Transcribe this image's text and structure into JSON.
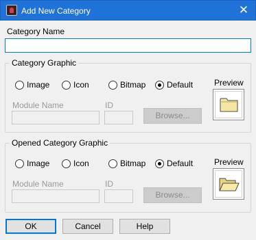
{
  "window": {
    "title": "Add New Category",
    "close_glyph": "✕",
    "icon": "app-icon"
  },
  "category_name": {
    "label": "Category Name",
    "value": ""
  },
  "groups": [
    {
      "title": "Category Graphic",
      "radios": [
        {
          "label": "Image",
          "checked": false
        },
        {
          "label": "Icon",
          "checked": false
        },
        {
          "label": "Bitmap",
          "checked": false
        },
        {
          "label": "Default",
          "checked": true
        }
      ],
      "module_label": "Module Name",
      "id_label": "ID",
      "browse_label": "Browse...",
      "preview_label": "Preview",
      "preview_icon": "closed-folder-icon"
    },
    {
      "title": "Opened Category Graphic",
      "radios": [
        {
          "label": "Image",
          "checked": false
        },
        {
          "label": "Icon",
          "checked": false
        },
        {
          "label": "Bitmap",
          "checked": false
        },
        {
          "label": "Default",
          "checked": true
        }
      ],
      "module_label": "Module Name",
      "id_label": "ID",
      "browse_label": "Browse...",
      "preview_label": "Preview",
      "preview_icon": "opened-folder-icon"
    }
  ],
  "buttons": {
    "ok": "OK",
    "cancel": "Cancel",
    "help": "Help"
  },
  "colors": {
    "titlebar": "#1f72d8",
    "focus": "#0078d7",
    "folder": "#f5e6a3"
  }
}
